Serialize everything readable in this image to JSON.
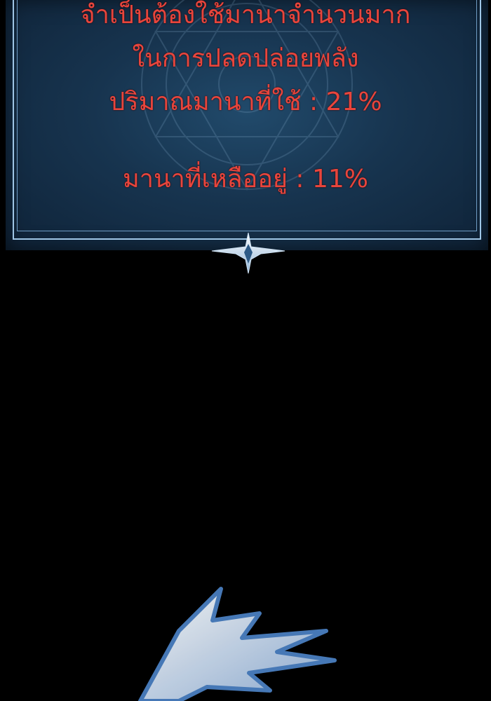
{
  "dialog": {
    "line1": "จำเป็นต้องใช้มานาจำนวนมาก",
    "line2": "ในการปลดปล่อยพลัง",
    "line3": "ปริมาณมานาที่ใช้ : 21%",
    "line4": "มานาที่เหลืออยู่ : 11%"
  },
  "colors": {
    "text": "#e8453c",
    "panel": "#17344f",
    "border": "#9fc6e6",
    "background": "#000000"
  }
}
